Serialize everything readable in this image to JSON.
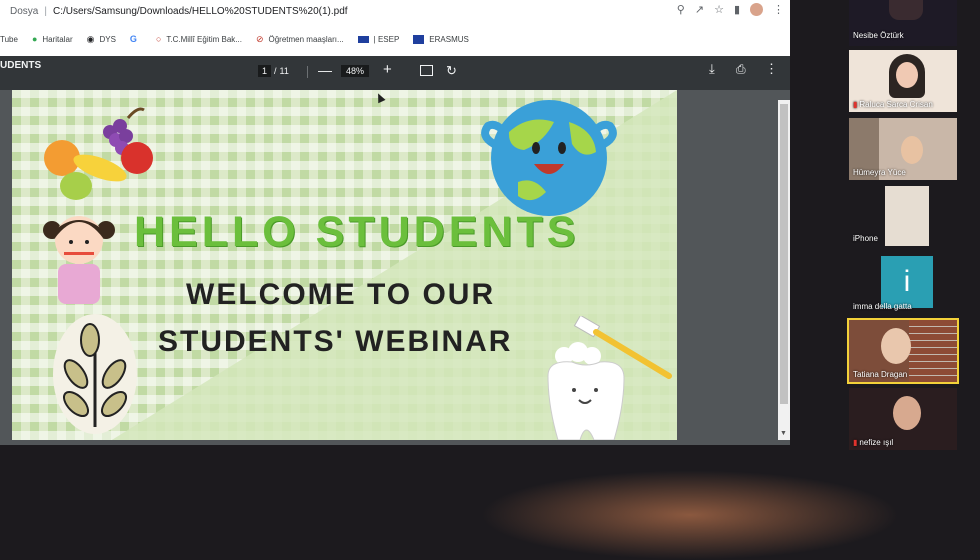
{
  "browser": {
    "scheme_label": "Dosya",
    "url": "C:/Users/Samsung/Downloads/HELLO%20STUDENTS%20(1).pdf",
    "icons": [
      "search-icon",
      "share-icon",
      "star-icon",
      "sidebar-icon",
      "profile-avatar",
      "more-icon"
    ]
  },
  "bookmarks": [
    {
      "label": "Tube",
      "icon": "youtube-icon"
    },
    {
      "label": "Haritalar",
      "icon": "maps-icon"
    },
    {
      "label": "DYS",
      "icon": "dys-icon"
    },
    {
      "label": "",
      "icon": "google-icon"
    },
    {
      "label": "T.C.Millî Eğitim Bak...",
      "icon": "meb-icon"
    },
    {
      "label": "Öğretmen maaşları...",
      "icon": "blocked-icon"
    },
    {
      "label": "| ESEP",
      "icon": "eu-flag-icon"
    },
    {
      "label": "ERASMUS",
      "icon": "erasmus-icon"
    }
  ],
  "pdf_toolbar": {
    "title": "UDENTS",
    "current_page": "1",
    "page_separator": "/",
    "total_pages": "11",
    "zoom": "48%"
  },
  "pdf_page": {
    "title": "HELLO STUDENTS",
    "line1": "WELCOME TO OUR",
    "line2": "STUDENTS' WEBINAR",
    "colors": {
      "title": "#6bbf3c",
      "body": "#222222"
    }
  },
  "participants": [
    {
      "name": "Nesibe Öztürk",
      "muted": false
    },
    {
      "name": "Raluca Sarca Crisan",
      "muted": true
    },
    {
      "name": "Hümeyra Yüce",
      "muted": false
    },
    {
      "name": "iPhone",
      "muted": false
    },
    {
      "name": "imma della gatta",
      "muted": false,
      "initial": "i"
    },
    {
      "name": "Tatiana Dragan",
      "muted": false,
      "active": true
    },
    {
      "name": "nefize ışıl",
      "muted": true
    }
  ]
}
